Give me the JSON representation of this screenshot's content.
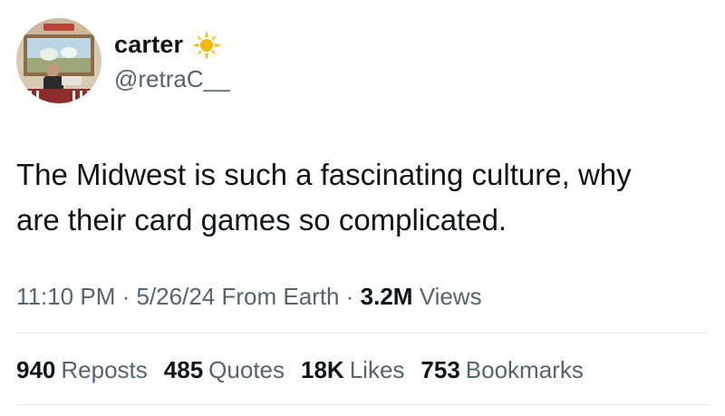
{
  "user": {
    "display_name": "carter",
    "handle": "@retraC__",
    "badge_icon": "sun-icon"
  },
  "tweet": {
    "text": "The Midwest is such a fascinating culture, why\nare their card games so complicated."
  },
  "meta": {
    "time": "11:10 PM",
    "separator": "·",
    "date": "5/26/24",
    "source": "From Earth",
    "views_count": "3.2M",
    "views_label": "Views"
  },
  "stats": {
    "reposts_count": "940",
    "reposts_label": "Reposts",
    "quotes_count": "485",
    "quotes_label": "Quotes",
    "likes_count": "18K",
    "likes_label": "Likes",
    "bookmarks_count": "753",
    "bookmarks_label": "Bookmarks"
  },
  "colors": {
    "text_primary": "#0f1419",
    "text_secondary": "#536471",
    "divider": "#e6e9eb",
    "sun": "#f5b800"
  }
}
